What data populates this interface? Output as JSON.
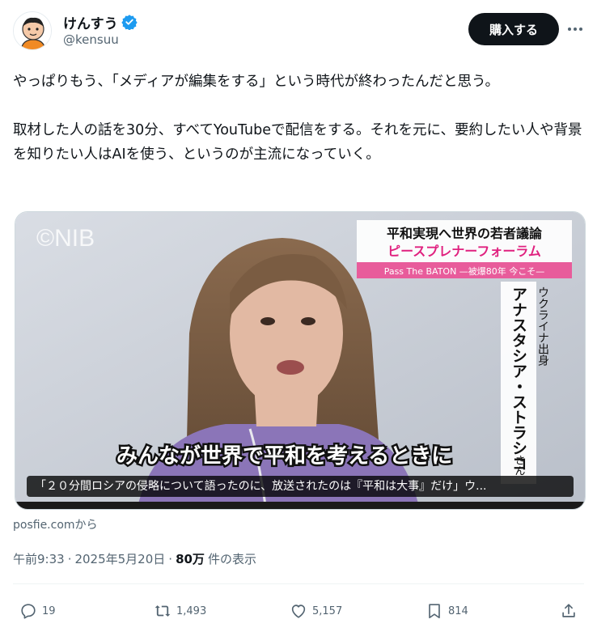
{
  "author": {
    "display_name": "けんすう",
    "handle": "@kensuu",
    "verified": true
  },
  "header": {
    "buy_label": "購入する"
  },
  "tweet": {
    "text": "やっぱりもう、「メディアが編集をする」という時代が終わったんだと思う。\n\n取材した人の話を30分、すべてYouTubeで配信をする。それを元に、要約したい人や背景を知りたい人はAIを使う、というのが主流になっていく。"
  },
  "media": {
    "watermark": "©NIB",
    "banner_title": "平和実現へ世界の若者議論",
    "banner_subtitle": "ピースプレナーフォーラム",
    "banner_tag": "Pass The BATON —被爆80年 今こそ—",
    "name_small": "ウクライナ出身",
    "name_large": "アナスタシア・ストラシコ",
    "name_suffix": "さん",
    "subtitle": "みんなが世界で平和を考えるときに",
    "caption": "「２０分間ロシアの侵略について語ったのに、放送されたのは『平和は大事』だけ」ウ..."
  },
  "source": "posfie.comから",
  "meta": {
    "time": "午前9:33",
    "separator": "·",
    "date": "2025年5月20日",
    "views_count": "80万",
    "views_label": "件の表示"
  },
  "actions": {
    "replies": "19",
    "reposts": "1,493",
    "likes": "5,157",
    "bookmarks": "814"
  },
  "colors": {
    "text": "#0f1419",
    "secondary": "#536471",
    "verified": "#1d9bf0",
    "button_bg": "#0f1419"
  },
  "icons": [
    "verified-icon",
    "more-icon",
    "reply-icon",
    "repost-icon",
    "like-icon",
    "bookmark-icon",
    "share-icon"
  ]
}
